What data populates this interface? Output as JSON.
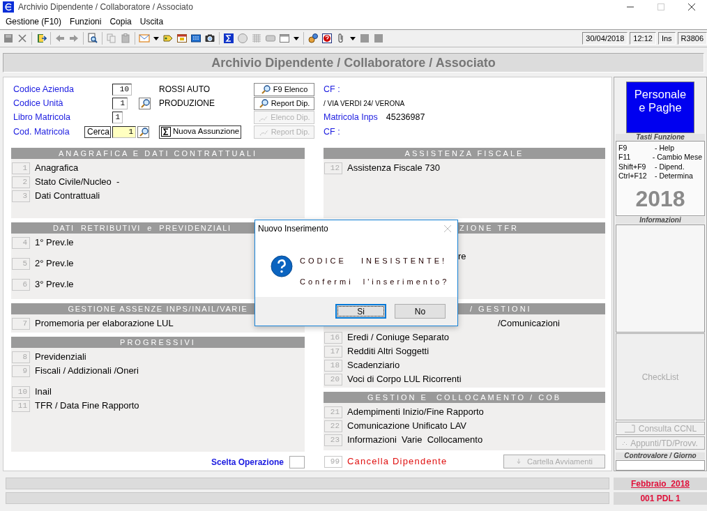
{
  "window": {
    "title": "Archivio Dipendente / Collaboratore / Associato"
  },
  "menu": [
    {
      "label": "Gestione (F10)"
    },
    {
      "label": "Funzioni"
    },
    {
      "label": "Copia"
    },
    {
      "label": "Uscita"
    }
  ],
  "status": [
    {
      "text": "30/04/2018"
    },
    {
      "text": "12:12"
    },
    {
      "text": "Ins"
    },
    {
      "text": "R3806"
    }
  ],
  "page_title": "Archivio Dipendente / Collaboratore / Associato",
  "form": {
    "rows": [
      {
        "label": "Codice Azienda",
        "value": "10",
        "focused": false,
        "lookup": false,
        "description": "ROSSI AUTO",
        "button": {
          "label": "F9 Elenco",
          "disabled": false
        },
        "info": [
          {
            "kind": "label",
            "text": "CF :"
          }
        ]
      },
      {
        "label": "Codice Unità",
        "value": "1",
        "focused": false,
        "lookup": true,
        "description": "PRODUZIONE",
        "button": {
          "label": "Report Dip.",
          "disabled": false
        },
        "info": [
          {
            "kind": "address",
            "text": "/ VIA VERDI 24/ VERONA"
          }
        ]
      },
      {
        "label": "Libro Matricola",
        "value": "1",
        "focused": false,
        "lookup": false,
        "button": {
          "label": "Elenco Dip.",
          "disabled": true
        },
        "info": [
          {
            "kind": "label",
            "text": "Matricola Inps"
          },
          {
            "kind": "value",
            "text": "45236987"
          }
        ]
      },
      {
        "label": "Cod. Matricola",
        "search_button": "Cerca",
        "value": "1",
        "focused": true,
        "lookup": true,
        "action": "Nuova Assunzione",
        "button": {
          "label": "Report Dip.",
          "disabled": true
        },
        "info": [
          {
            "kind": "label",
            "text": "CF :"
          }
        ]
      }
    ]
  },
  "columns": [
    {
      "sections": [
        {
          "title": "ANAGRAFICA E DATI CONTRATTUALI",
          "items": [
            {
              "kind": "entry",
              "number": "1",
              "label": "Anagrafica"
            },
            {
              "kind": "entry",
              "number": "2",
              "label": "Stato Civile/Nucleo  -"
            },
            {
              "kind": "entry",
              "number": "3",
              "label": "Dati Contrattuali"
            }
          ]
        },
        {
          "title": "DATI  RETRIBUTIVI  e  PREVIDENZIALI",
          "items": [
            {
              "kind": "entry",
              "number": "4",
              "label": "1° Prev.le"
            },
            {
              "kind": "entry",
              "number": "5",
              "label": "2° Prev.le"
            },
            {
              "kind": "entry",
              "number": "6",
              "label": "3° Prev.le"
            }
          ]
        },
        {
          "title": "GESTIONE ASSENZE INPS/INAIL/VARIE",
          "items": [
            {
              "kind": "entry",
              "number": "7",
              "label": "Promemoria per elaborazione LUL"
            }
          ]
        },
        {
          "title": "PROGRESSIVI",
          "items": [
            {
              "kind": "entry",
              "number": "8",
              "label": "Previdenziali"
            },
            {
              "kind": "entry",
              "number": "9",
              "label": "Fiscali / Addizionali /Oneri"
            },
            {
              "kind": "entry",
              "number": "10",
              "label": "Inail"
            },
            {
              "kind": "entry",
              "number": "11",
              "label": "TFR / Data Fine Rapporto"
            }
          ]
        }
      ]
    },
    {
      "sections": [
        {
          "title": "ASSISTENZA FISCALE",
          "items": [
            {
              "kind": "entry",
              "number": "12",
              "label": "Assistenza Fiscale 730"
            }
          ]
        },
        {
          "title": "ZIONE TFR",
          "items": [
            {
              "kind": "fragment",
              "label": "re"
            }
          ]
        },
        {
          "title": "/ GESTIONI",
          "items": [
            {
              "kind": "fragment",
              "label": "/Comunicazioni"
            },
            {
              "kind": "entry",
              "number": "16",
              "label": "Eredi / Coniuge Separato"
            },
            {
              "kind": "entry",
              "number": "17",
              "label": "Redditi Altri Soggetti"
            },
            {
              "kind": "entry",
              "number": "18",
              "label": "Scadenziario"
            },
            {
              "kind": "entry",
              "number": "20",
              "label": "Voci di Corpo LUL Ricorrenti"
            }
          ]
        },
        {
          "title": "GESTION E  COLLOCAMENTO / COB",
          "items": [
            {
              "kind": "entry",
              "number": "21",
              "label": "Adempimenti Inizio/Fine Rapporto"
            },
            {
              "kind": "entry",
              "number": "22",
              "label": "Comunicazione Unificato LAV"
            },
            {
              "kind": "entry",
              "number": "23",
              "label": "Informazioni  Varie  Collocamento"
            }
          ]
        }
      ]
    }
  ],
  "choice": {
    "label": "Scelta Operazione"
  },
  "delete": {
    "number": "99",
    "label": "Cancella Dipendente"
  },
  "side_button": {
    "label": "Cartella Avviamenti",
    "disabled": true
  },
  "sidebar": {
    "logo": "Personale e Paghe",
    "keys_title": "Tasti Funzione",
    "keys": [
      {
        "key": "F9",
        "action": "- Help"
      },
      {
        "key": "F11",
        "action": "- Cambio Mese"
      },
      {
        "key": "Shift+F9",
        "action": "- Dipend."
      },
      {
        "key": "Ctrl+F12",
        "action": "- Determina"
      }
    ],
    "year": "2018",
    "info_title": "Informazioni",
    "checklist": {
      "label": "CheckList",
      "disabled": true
    },
    "buttons": [
      {
        "label": "Consulta CCNL",
        "disabled": true
      },
      {
        "label": "Appunti/TD/Provv.",
        "disabled": true
      }
    ],
    "value_title": "Controvalore / Giorno"
  },
  "footer": {
    "period": "Febbraio  2018",
    "office": "001 PDL 1"
  },
  "dialog": {
    "title": "Nuovo Inserimento",
    "lines": [
      "CODICE   INESISTENTE!",
      "Confermi  l'inserimento?"
    ],
    "buttons": [
      {
        "label": "Si",
        "default": true
      },
      {
        "label": "No",
        "default": false
      }
    ]
  }
}
